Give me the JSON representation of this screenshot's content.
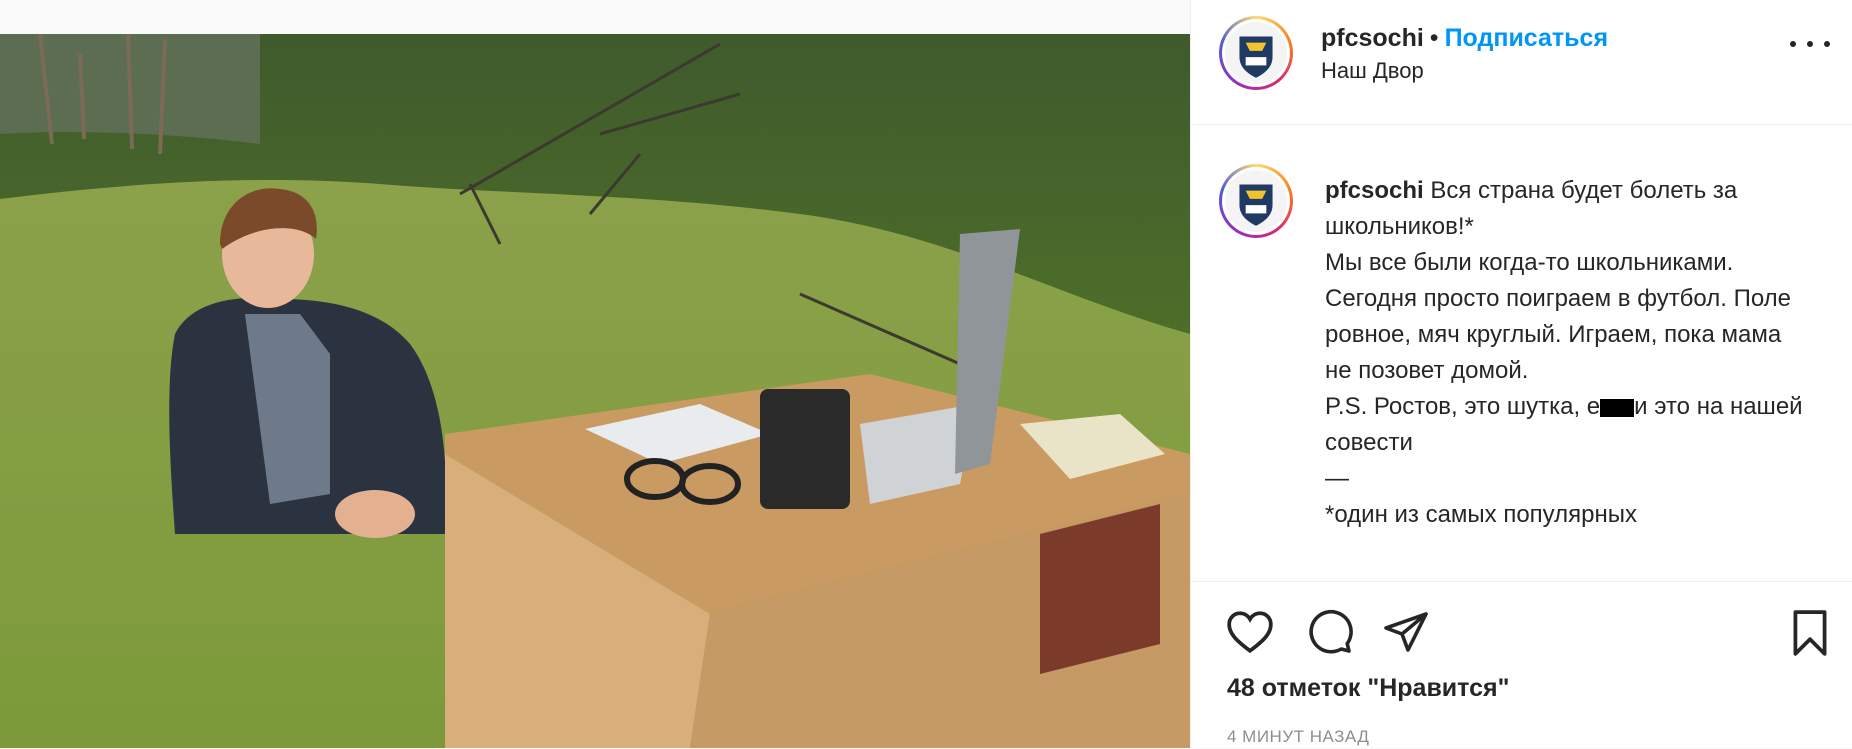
{
  "post": {
    "username": "pfcsochi",
    "dot": "•",
    "follow_label": "Подписаться",
    "location": "Наш Двор",
    "caption_lines": [
      "Вся страна будет болеть за школьников!*",
      "Мы все были когда-то школьниками. Сегодня просто поиграем в футбол. Поле ровное, мяч круглый. Играем, пока мама не позовет домой.",
      "P.S. Ростов, это шутка, е",
      "и это на нашей совести",
      "—",
      "*один из самых популярных"
    ],
    "likes": "48 отметок \"Нравится\"",
    "time": "4 МИНУТ НАЗАД"
  },
  "icons": {
    "like": "heart-icon",
    "comment": "comment-icon",
    "share": "paper-plane-icon",
    "save": "bookmark-icon",
    "more": "more-options-icon"
  },
  "colors": {
    "follow": "#0095f6",
    "text": "#262626",
    "muted": "#8e8e8e",
    "border": "#efefef"
  }
}
